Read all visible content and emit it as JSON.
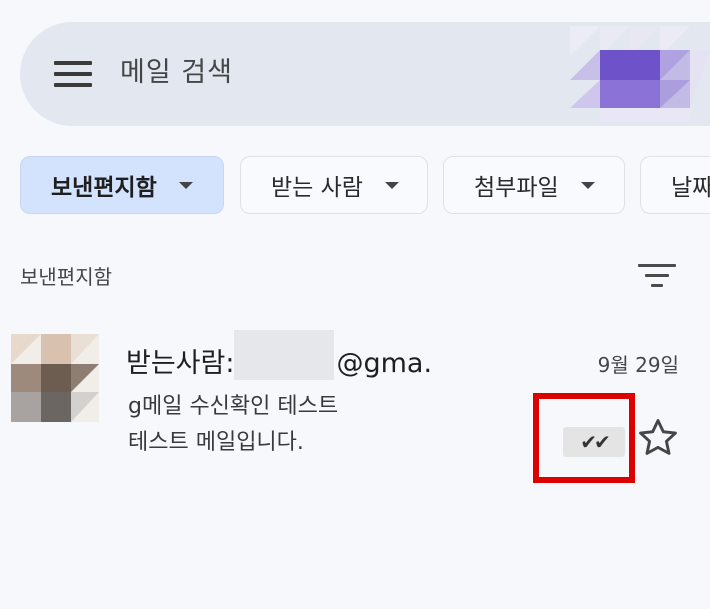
{
  "search": {
    "placeholder": "메일 검색"
  },
  "filters": [
    {
      "label": "보낸편지함",
      "active": true
    },
    {
      "label": "받는 사람"
    },
    {
      "label": "첨부파일"
    },
    {
      "label": "날짜"
    }
  ],
  "folder_title": "보낸편지함",
  "email": {
    "sender_prefix": "받는사람:",
    "sender_suffix": "@gma.",
    "date": "9월 29일",
    "subject": "g메일 수신확인 테스트",
    "snippet": "테스트 메일입니다.",
    "read_receipt": "✔✔"
  },
  "icons": {
    "menu": "hamburger-menu-icon",
    "sort": "sort-filter-icon",
    "star": "star-outline-icon",
    "read": "double-check-icon"
  },
  "colors": {
    "background": "#f6f8fc",
    "search_bar": "#e3e8f0",
    "active_chip": "#d3e3fd",
    "highlight_box": "#dd0000",
    "avatar_purple": "#6a4fc8"
  }
}
